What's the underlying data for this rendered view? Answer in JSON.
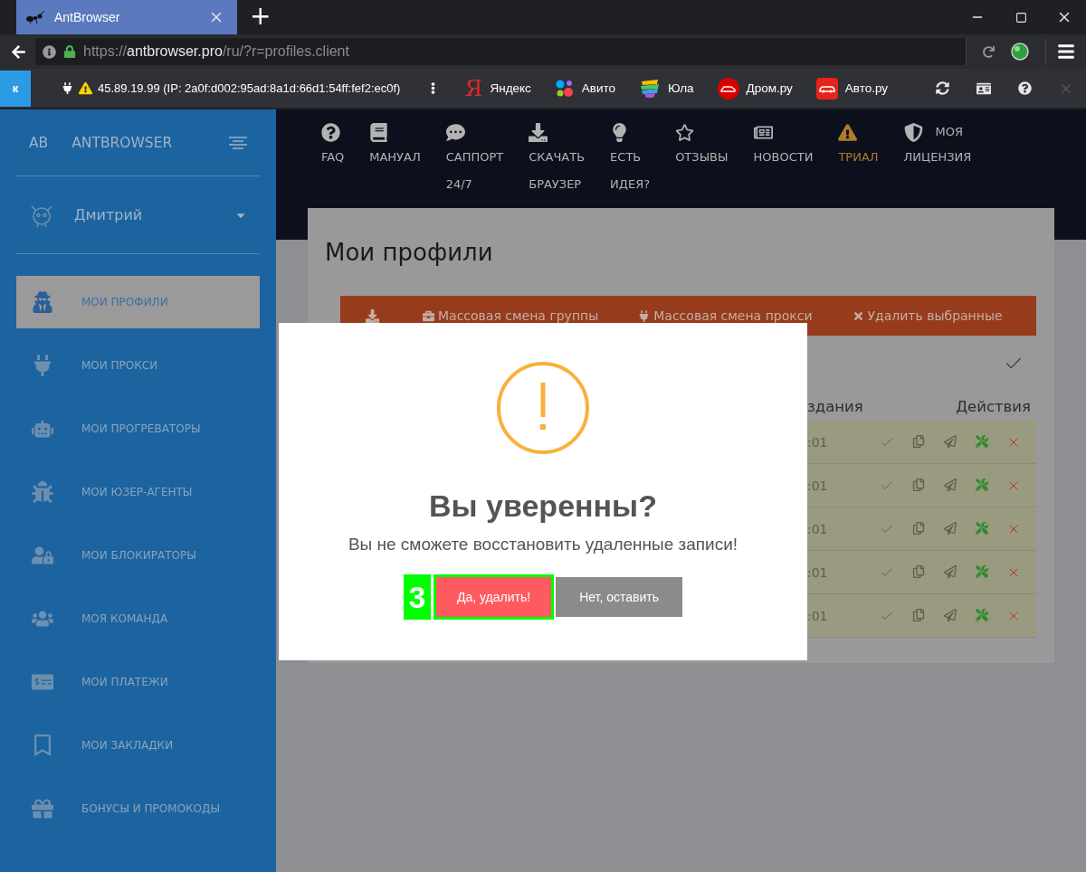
{
  "browser": {
    "tab": {
      "title": "AntBrowser",
      "selected": true
    },
    "new_tab": "+",
    "address": {
      "scheme": "https://",
      "domain": "antbrowser.pro",
      "path": "/ru/?r=profiles.client"
    }
  },
  "bookmarks_bar": {
    "profile_badge": "к",
    "proxy": "45.89.19.99 (IP: 2a0f:d002:95ad:8a1d:66d1:54ff:fef2:ec0f)",
    "bookmarks": [
      {
        "label": "Яндекс",
        "icon_text": "Я"
      },
      {
        "label": "Авито"
      },
      {
        "label": "Юла"
      },
      {
        "label": "Дром.ру"
      },
      {
        "label": "Авто.ру"
      }
    ]
  },
  "sidebar": {
    "logo_short": "AB",
    "logo": "ANTBROWSER",
    "user": "Дмитрий",
    "items": [
      {
        "label": "МОИ ПРОФИЛИ",
        "selected": true
      },
      {
        "label": "МОИ ПРОКСИ",
        "selected": false
      },
      {
        "label": "МОИ ПРОГРЕВАТОРЫ",
        "selected": false
      },
      {
        "label": "МОИ ЮЗЕР-АГЕНТЫ",
        "selected": false
      },
      {
        "label": "МОИ БЛОКИРАТОРЫ",
        "selected": false
      },
      {
        "label": "МОЯ КОМАНДА",
        "selected": false
      },
      {
        "label": "МОИ ПЛАТЕЖИ",
        "selected": false
      },
      {
        "label": "МОИ ЗАКЛАДКИ",
        "selected": false
      },
      {
        "label": "БОНУСЫ И ПРОМОКОДЫ",
        "selected": false
      }
    ]
  },
  "top_nav": [
    {
      "lines": [
        "FAQ"
      ],
      "kind": "stacked",
      "highlighted": false
    },
    {
      "lines": [
        "МАНУАЛ"
      ],
      "kind": "stacked",
      "highlighted": false
    },
    {
      "lines": [
        "САППОРТ",
        "24/7"
      ],
      "kind": "stacked",
      "highlighted": false
    },
    {
      "lines": [
        "СКАЧАТЬ",
        "БРАУЗЕР"
      ],
      "kind": "stacked",
      "highlighted": false
    },
    {
      "lines": [
        "ЕСТЬ",
        "ИДЕЯ?"
      ],
      "kind": "stacked",
      "highlighted": false
    },
    {
      "lines": [
        "ОТЗЫВЫ"
      ],
      "kind": "stacked",
      "highlighted": false
    },
    {
      "lines": [
        "НОВОСТИ"
      ],
      "kind": "stacked",
      "highlighted": false
    },
    {
      "lines": [
        "ТРИАЛ"
      ],
      "kind": "stacked",
      "highlighted": true
    },
    {
      "lines": [
        "МОЯ",
        "ЛИЦЕНЗИЯ"
      ],
      "kind": "inline",
      "highlighted": false
    }
  ],
  "page": {
    "title": "Мои профили",
    "bulk_actions": [
      {
        "label": "Массовая смена группы"
      },
      {
        "label": "Массовая смена прокси"
      },
      {
        "label": "Удалить выбранные"
      }
    ],
    "table": {
      "columns": [
        "здания",
        "Действия"
      ],
      "rows": [
        {
          "created": ":01"
        },
        {
          "created": ":01"
        },
        {
          "created": ":01"
        },
        {
          "created": ":01"
        },
        {
          "created": ":01"
        }
      ]
    }
  },
  "dialog": {
    "title": "Вы уверенны?",
    "text": "Вы не сможете восстановить удаленные записи!",
    "step_badge": "3",
    "confirm": "Да, удалить!",
    "cancel": "Нет, оставить"
  }
}
